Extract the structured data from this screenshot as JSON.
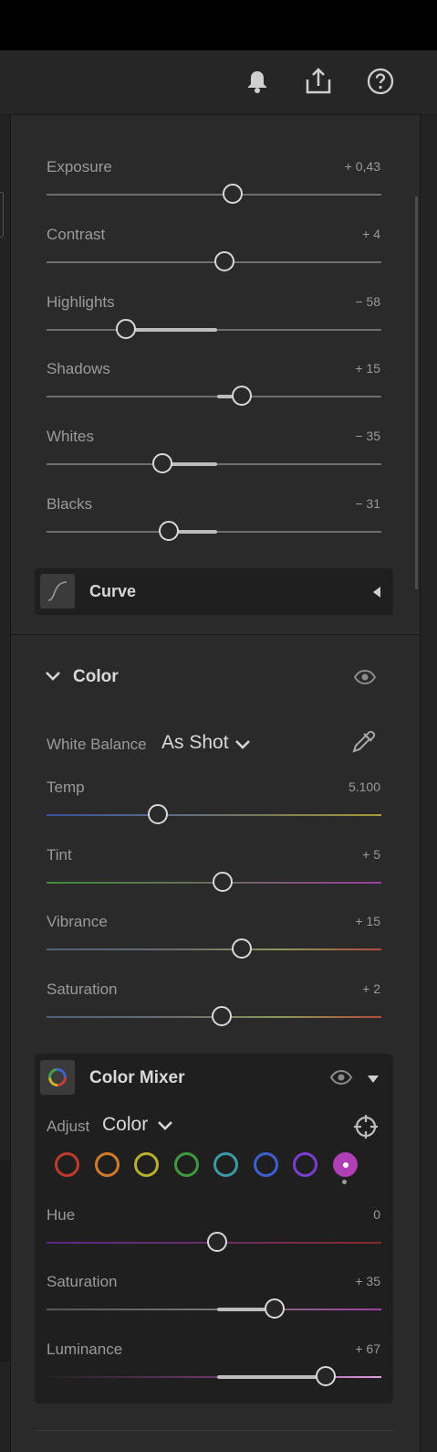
{
  "toolbar": {
    "icons": [
      "bell-icon",
      "share-icon",
      "help-icon"
    ]
  },
  "light": {
    "sliders": [
      {
        "id": "exposure",
        "label": "Exposure",
        "value": "+ 0,43",
        "position": 0.556,
        "fill_from": null
      },
      {
        "id": "contrast",
        "label": "Contrast",
        "value": "+ 4",
        "position": 0.532,
        "fill_from": null
      },
      {
        "id": "highlights",
        "label": "Highlights",
        "value": "− 58",
        "position": 0.237,
        "fill_from": 0.51
      },
      {
        "id": "shadows",
        "label": "Shadows",
        "value": "+ 15",
        "position": 0.582,
        "fill_from": 0.51
      },
      {
        "id": "whites",
        "label": "Whites",
        "value": "− 35",
        "position": 0.346,
        "fill_from": 0.51
      },
      {
        "id": "blacks",
        "label": "Blacks",
        "value": "− 31",
        "position": 0.365,
        "fill_from": 0.51
      }
    ],
    "curve_label": "Curve"
  },
  "color": {
    "title": "Color",
    "white_balance": {
      "label": "White Balance",
      "value": "As Shot"
    },
    "sliders": [
      {
        "id": "temp",
        "label": "Temp",
        "value": "5.100",
        "position": 0.332,
        "gradient": "linear-gradient(90deg,#3a4f9a 0%,#5a6b8a 35%,#7a7a5a 65%,#a89a35 100%)"
      },
      {
        "id": "tint",
        "label": "Tint",
        "value": "+ 5",
        "position": 0.527,
        "gradient": "linear-gradient(90deg,#3f8a3a 0%,#6a6a5a 50%,#9a3fa0 100%)"
      },
      {
        "id": "vibrance",
        "label": "Vibrance",
        "value": "+ 15",
        "position": 0.582,
        "gradient": "linear-gradient(90deg,#4d5f7a 0%,#6d6d6d 40%,#8a9a5a 70%,#b04a3a 100%)"
      },
      {
        "id": "saturation",
        "label": "Saturation",
        "value": "+ 2",
        "position": 0.523,
        "gradient": "linear-gradient(90deg,#4d5f7a 0%,#6d6d6d 40%,#8a9a5a 70%,#b04a3a 100%)"
      }
    ]
  },
  "color_mixer": {
    "title": "Color Mixer",
    "adjust": {
      "label": "Adjust",
      "value": "Color"
    },
    "swatches": [
      {
        "name": "red",
        "color": "#c0392b"
      },
      {
        "name": "orange",
        "color": "#d07a2a"
      },
      {
        "name": "yellow",
        "color": "#b8b030"
      },
      {
        "name": "green",
        "color": "#3f9a3f"
      },
      {
        "name": "aqua",
        "color": "#3a9aa5"
      },
      {
        "name": "blue",
        "color": "#3f5fd0"
      },
      {
        "name": "purple",
        "color": "#7a3fd0"
      },
      {
        "name": "magenta",
        "color": "#b03fb5",
        "selected": true
      }
    ],
    "sliders": [
      {
        "id": "hue",
        "label": "Hue",
        "value": "0",
        "position": 0.51,
        "gradient": "linear-gradient(90deg,#5a2a8a 0%,#6a2f6a 50%,#8a2a2a 100%)"
      },
      {
        "id": "cm-saturation",
        "label": "Saturation",
        "value": "+ 35",
        "position": 0.68,
        "gradient": "linear-gradient(90deg,#555 0%,#777 50%,#a03fa5 100%)",
        "fill_from": 0.51
      },
      {
        "id": "luminance",
        "label": "Luminance",
        "value": "+ 67",
        "position": 0.834,
        "gradient": "linear-gradient(90deg,#222 0%,#7a3a7a 60%,#e0a0e0 100%)",
        "fill_from": 0.51
      }
    ]
  },
  "accent_colors": {
    "panel": "#2a2a2a",
    "track": "#6d6d6d",
    "knob": "#d8d8d8"
  }
}
